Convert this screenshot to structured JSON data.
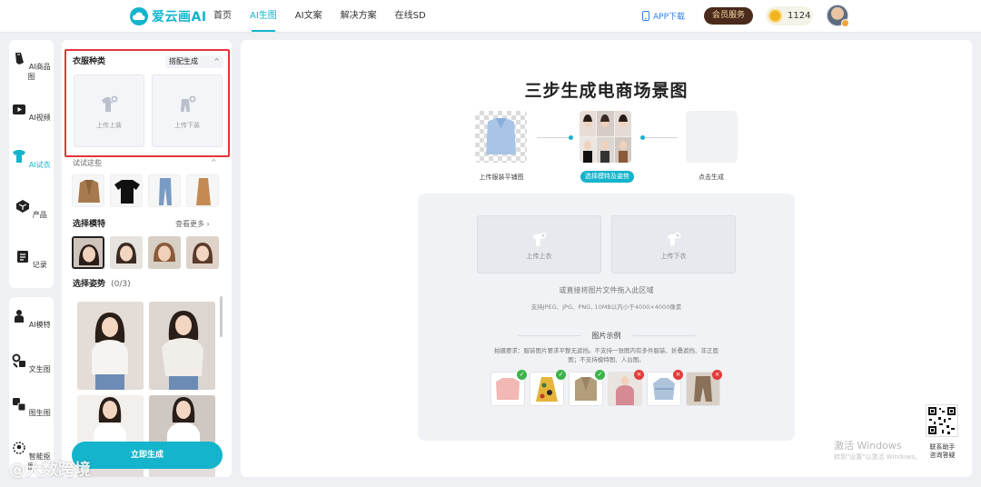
{
  "brand": {
    "name": "爱云画AI",
    "color": "#14b4cc"
  },
  "nav": {
    "items": [
      "首页",
      "AI生图",
      "AI文案",
      "解决方案",
      "在线SD"
    ],
    "active_index": 1
  },
  "header": {
    "app_download": "APP下载",
    "vip_label": "会员服务",
    "coins": "1124"
  },
  "rail": {
    "items": [
      {
        "label": "AI商品图",
        "icon": "pencil-icon"
      },
      {
        "label": "AI视频",
        "icon": "video-icon"
      },
      {
        "label": "AI试衣",
        "icon": "shirt-icon",
        "active": true
      },
      {
        "label": "产品",
        "icon": "cube-icon"
      },
      {
        "label": "记录",
        "icon": "clipboard-icon"
      }
    ],
    "items2": [
      {
        "label": "AI模特",
        "icon": "person-icon"
      },
      {
        "label": "文生图",
        "icon": "text-image-icon"
      },
      {
        "label": "图生图",
        "icon": "image-image-icon"
      },
      {
        "label": "智能抠图",
        "icon": "cutout-icon"
      }
    ]
  },
  "panel": {
    "cloth_title": "衣服种类",
    "mix_label": "搭配生成",
    "upload_top": "上传上装",
    "upload_bottom": "上传下装",
    "try_these": "试试这些",
    "model_title": "选择模特",
    "see_more": "查看更多",
    "pose_title": "选择姿势",
    "pose_count": "(0/3)",
    "generate": "立即生成"
  },
  "main": {
    "title": "三步生成电商场景图",
    "steps": [
      "上传服装平铺图",
      "选择模特及姿势",
      "点击生成"
    ],
    "active_step": 1,
    "upload_top": "上传上衣",
    "upload_bottom": "上传下衣",
    "drop_hint": "或直接将图片文件拖入此区域",
    "support_hint": "支持JPEG、JPG、PNG, 10MB以内小于4000×4000像素",
    "example_title": "图片示例",
    "example_note": "拍摄要求：服装图片要求平整无遮挡。不支持一张图内有多件服装、折叠遮挡、非正面图；不支持模特图、人台图。",
    "examples": [
      {
        "name": "pink-sweater",
        "ok": true,
        "color": "#f2b8b4"
      },
      {
        "name": "floral-dress",
        "ok": true,
        "color": "#e4b53a"
      },
      {
        "name": "khaki-blazer",
        "ok": true,
        "color": "#b29d7c"
      },
      {
        "name": "model-wearing",
        "ok": false,
        "color": "#d68a94"
      },
      {
        "name": "folded-shirt",
        "ok": false,
        "color": "#aec4dc"
      },
      {
        "name": "mannequin",
        "ok": false,
        "color": "#8a7058"
      }
    ]
  },
  "contact": {
    "label": "联系助手\n咨询答疑"
  },
  "watermark": {
    "windows": "激活 Windows",
    "windows_sub": "转到\"设置\"以激活 Windows。",
    "bottom": "@大数跨境"
  }
}
